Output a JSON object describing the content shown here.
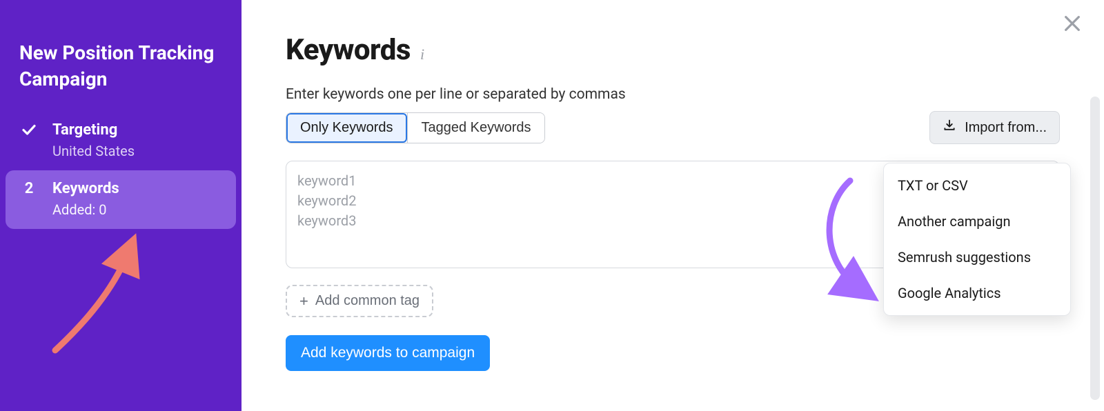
{
  "sidebar": {
    "title": "New Position Tracking Campaign",
    "steps": [
      {
        "label": "Targeting",
        "sub": "United States",
        "done": true
      },
      {
        "num": "2",
        "label": "Keywords",
        "sub": "Added: 0",
        "active": true
      }
    ]
  },
  "header": {
    "title": "Keywords"
  },
  "instruction": "Enter keywords one per line or separated by commas",
  "modes": {
    "only": "Only Keywords",
    "tagged": "Tagged Keywords"
  },
  "import_button": "Import from...",
  "import_menu": {
    "txt_csv": "TXT or CSV",
    "another_campaign": "Another campaign",
    "semrush_suggestions": "Semrush suggestions",
    "google_analytics": "Google Analytics"
  },
  "textarea_placeholder": "keyword1\nkeyword2\nkeyword3",
  "add_common_tag": "Add common tag",
  "primary": "Add keywords to campaign"
}
